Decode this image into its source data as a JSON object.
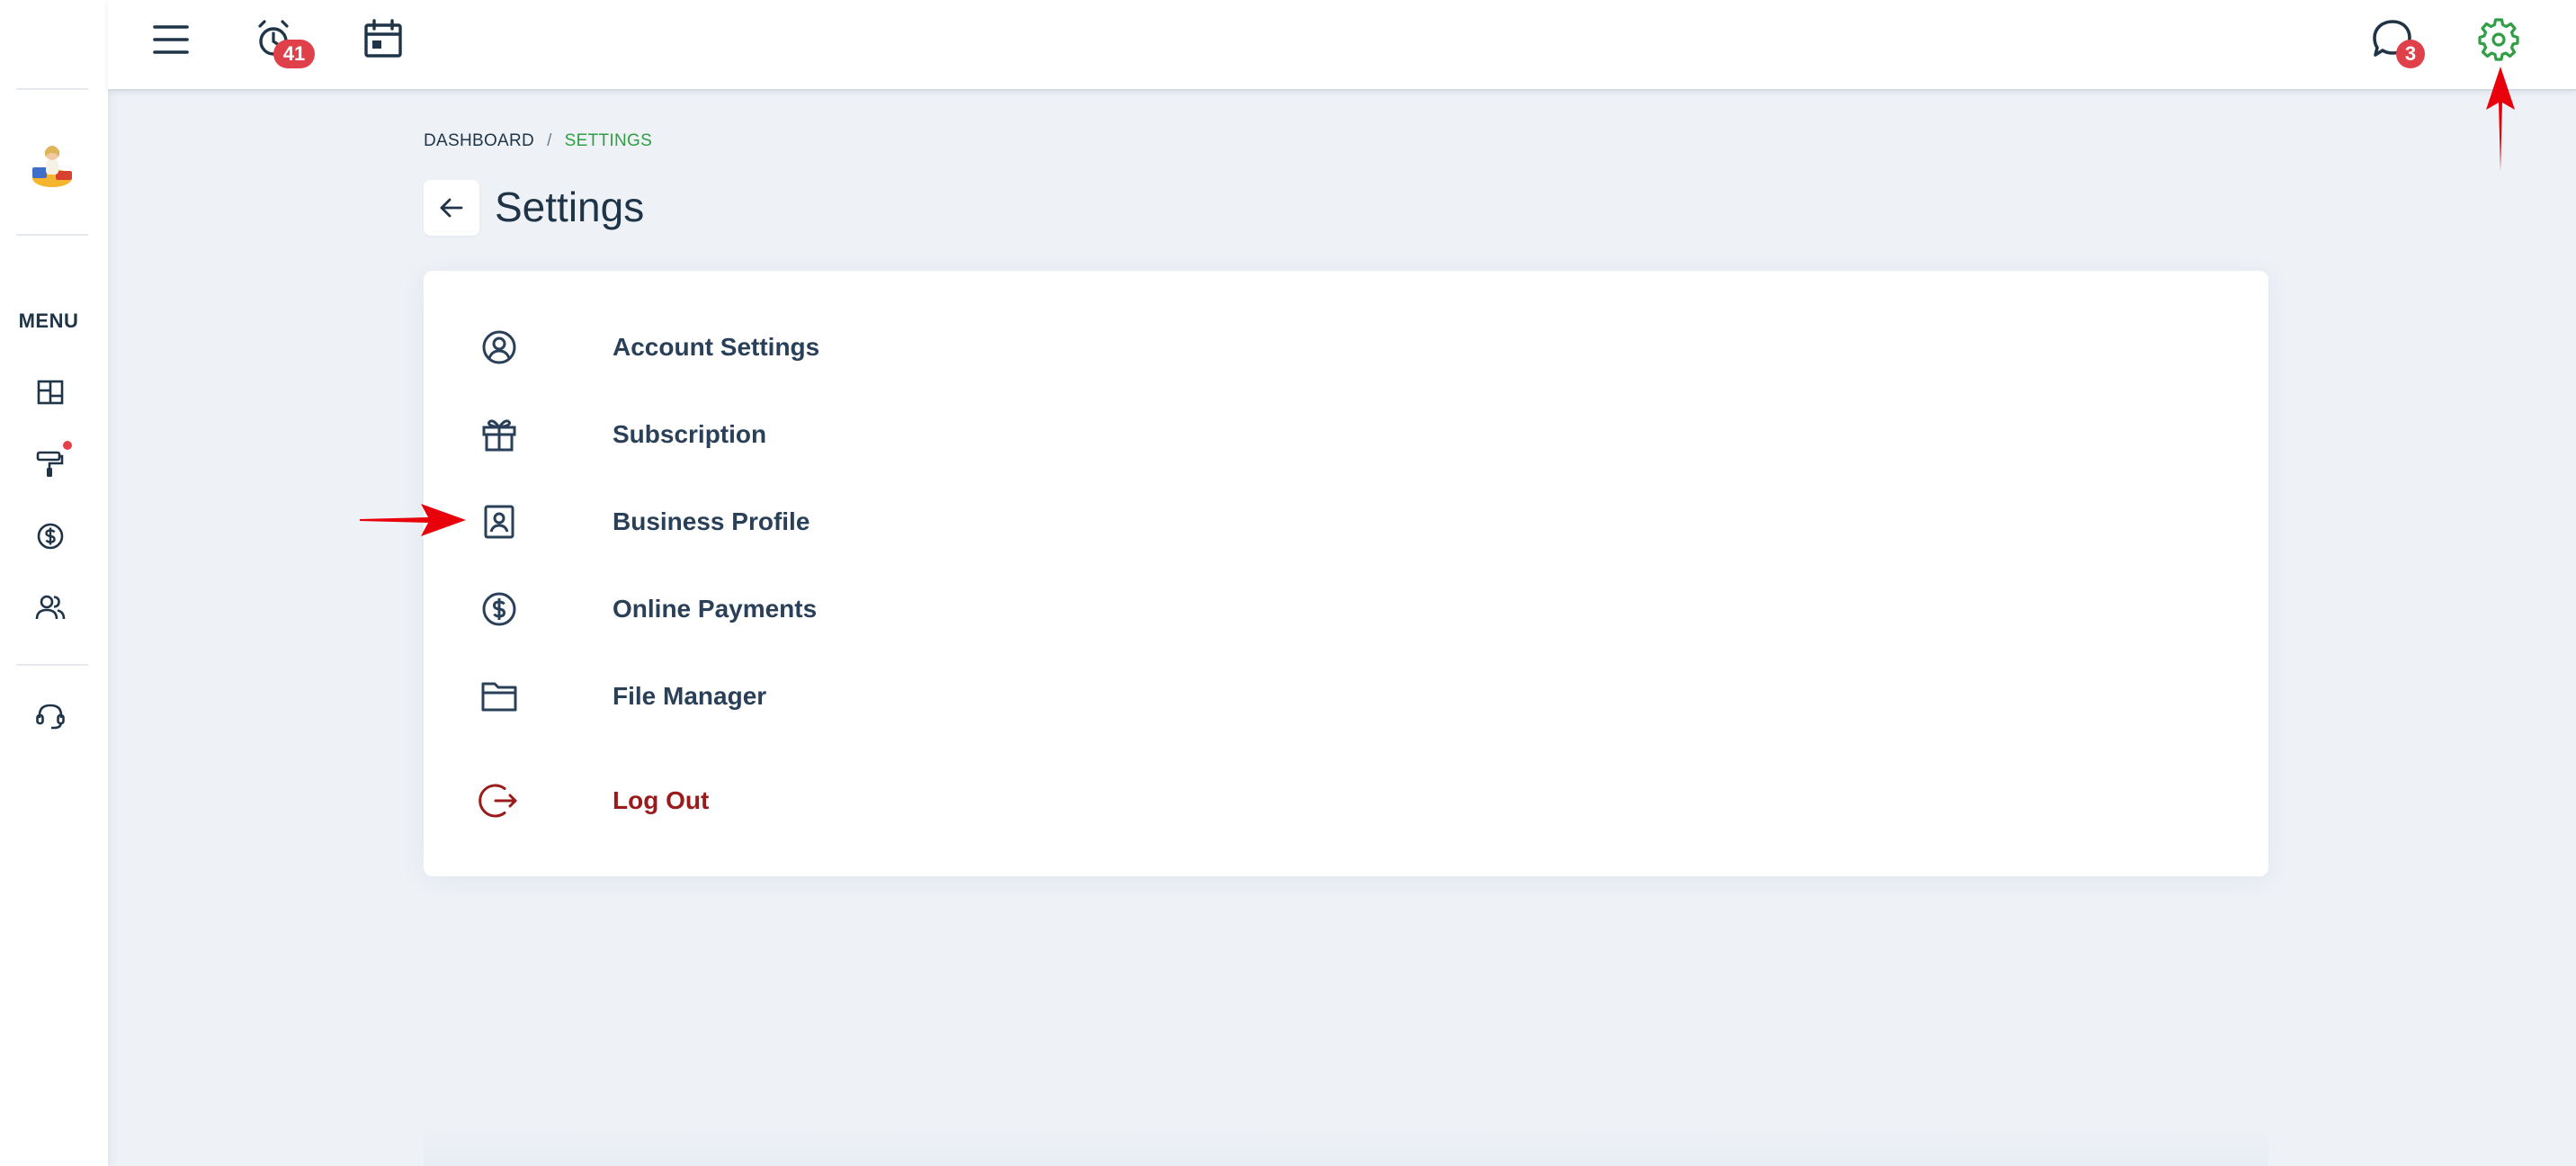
{
  "sidebar": {
    "menu_label": "MENU",
    "avatar_alt": "user avatar",
    "items": [
      {
        "name": "dashboard",
        "icon": "layout-grid-icon"
      },
      {
        "name": "paint-jobs",
        "icon": "paint-roller-icon",
        "has_notification_dot": true
      },
      {
        "name": "payments",
        "icon": "dollar-circle-icon"
      },
      {
        "name": "customers",
        "icon": "users-icon"
      },
      {
        "name": "support",
        "icon": "headset-icon"
      }
    ]
  },
  "topbar": {
    "alarm_badge": "41",
    "chat_badge": "3",
    "icons": [
      "hamburger-menu-icon",
      "alarm-clock-icon",
      "calendar-icon",
      "chat-bubble-icon",
      "gear-icon"
    ]
  },
  "breadcrumb": {
    "root": "DASHBOARD",
    "separator": "/",
    "current": "SETTINGS"
  },
  "page": {
    "title": "Settings"
  },
  "settings_menu": [
    {
      "label": "Account Settings",
      "icon": "user-circle-icon"
    },
    {
      "label": "Subscription",
      "icon": "gift-icon"
    },
    {
      "label": "Business Profile",
      "icon": "contact-card-icon"
    },
    {
      "label": "Online Payments",
      "icon": "dollar-circle-icon"
    },
    {
      "label": "File Manager",
      "icon": "folder-icon"
    },
    {
      "label": "Log Out",
      "icon": "logout-icon"
    }
  ],
  "colors": {
    "accent_green": "#2f9e44",
    "badge_red": "#e0404a",
    "logout_red": "#9a1b1b",
    "text_dark": "#1f3447",
    "background": "#eef2f7",
    "annotation_red": "#e8000a"
  }
}
